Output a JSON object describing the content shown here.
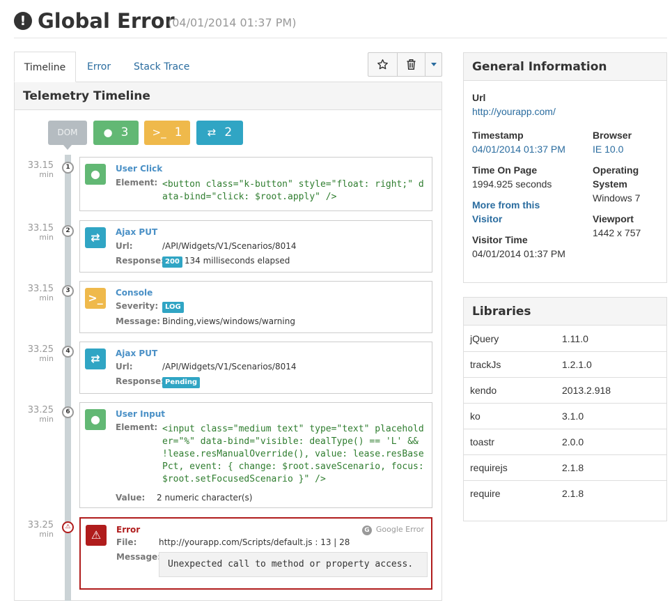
{
  "header": {
    "icon": "exclamation-circle-icon",
    "title": "Global Error",
    "timestamp": "(04/01/2014 01:37 PM)"
  },
  "tabs": [
    {
      "label": "Timeline",
      "active": true
    },
    {
      "label": "Error"
    },
    {
      "label": "Stack Trace"
    }
  ],
  "toolbar": {
    "star_icon": "star-icon",
    "trash_icon": "trash-icon",
    "dropdown_icon": "caret-down-icon"
  },
  "timeline": {
    "title": "Telemetry Timeline",
    "summary": {
      "dom_label": "DOM",
      "user_count": "3",
      "console_count": "1",
      "ajax_count": "2"
    },
    "events": [
      {
        "time": "33.15",
        "unit": "min",
        "num": "1",
        "type": "User Click",
        "label1": "Element:",
        "code": "<button class=\"k-button\" style=\"float: right;\" data-bind=\"click: $root.apply\" />"
      },
      {
        "time": "33.15",
        "unit": "min",
        "num": "2",
        "type": "Ajax PUT",
        "label1": "Url:",
        "url": "/API/Widgets/V1/Scenarios/8014",
        "label2": "Response:",
        "status": "200",
        "detail": "134 milliseconds elapsed"
      },
      {
        "time": "33.15",
        "unit": "min",
        "num": "3",
        "type": "Console",
        "label1": "Severity:",
        "severity": "LOG",
        "label2": "Message:",
        "message": "Binding,views/windows/warning"
      },
      {
        "time": "33.25",
        "unit": "min",
        "num": "4",
        "type": "Ajax PUT",
        "label1": "Url:",
        "url": "/API/Widgets/V1/Scenarios/8014",
        "label2": "Response:",
        "status": "Pending"
      },
      {
        "time": "33.25",
        "unit": "min",
        "num": "6",
        "type": "User Input",
        "label1": "Element:",
        "code": "<input class=\"medium text\" type=\"text\" placeholder=\"%\" data-bind=\"visible: dealType() == 'L' && !lease.resManualOverride(), value: lease.resBasePct, event: { change: $root.saveScenario, focus: $root.setFocusedScenario }\" />",
        "label2": "Value:",
        "value": "2 numeric character(s)"
      },
      {
        "time": "33.25",
        "unit": "min",
        "type": "Error",
        "label1": "File:",
        "file": "http://yourapp.com/Scripts/default.js : 13 | 28",
        "label2": "Message:",
        "message": "Unexpected call to method or property access.",
        "google": "Google Error"
      }
    ]
  },
  "general": {
    "title": "General Information",
    "url_label": "Url",
    "url": "http://yourapp.com/",
    "timestamp_label": "Timestamp",
    "timestamp": "04/01/2014 01:37 PM",
    "browser_label": "Browser",
    "browser": "IE 10.0",
    "time_on_page_label": "Time On Page",
    "time_on_page": "1994.925 seconds",
    "os_label_1": "Operating",
    "os_label_2": "System",
    "os": "Windows 7",
    "more_1": "More from this",
    "more_2": "Visitor",
    "viewport_label": "Viewport",
    "viewport": "1442 x 757",
    "visitor_time_label": "Visitor Time",
    "visitor_time": "04/01/2014 01:37 PM"
  },
  "libraries": {
    "title": "Libraries",
    "rows": [
      {
        "name": "jQuery",
        "version": "1.11.0"
      },
      {
        "name": "trackJs",
        "version": "1.2.1.0"
      },
      {
        "name": "kendo",
        "version": "2013.2.918"
      },
      {
        "name": "ko",
        "version": "3.1.0"
      },
      {
        "name": "toastr",
        "version": "2.0.0"
      },
      {
        "name": "requirejs",
        "version": "2.1.8"
      },
      {
        "name": "require",
        "version": "2.1.8"
      }
    ]
  }
}
